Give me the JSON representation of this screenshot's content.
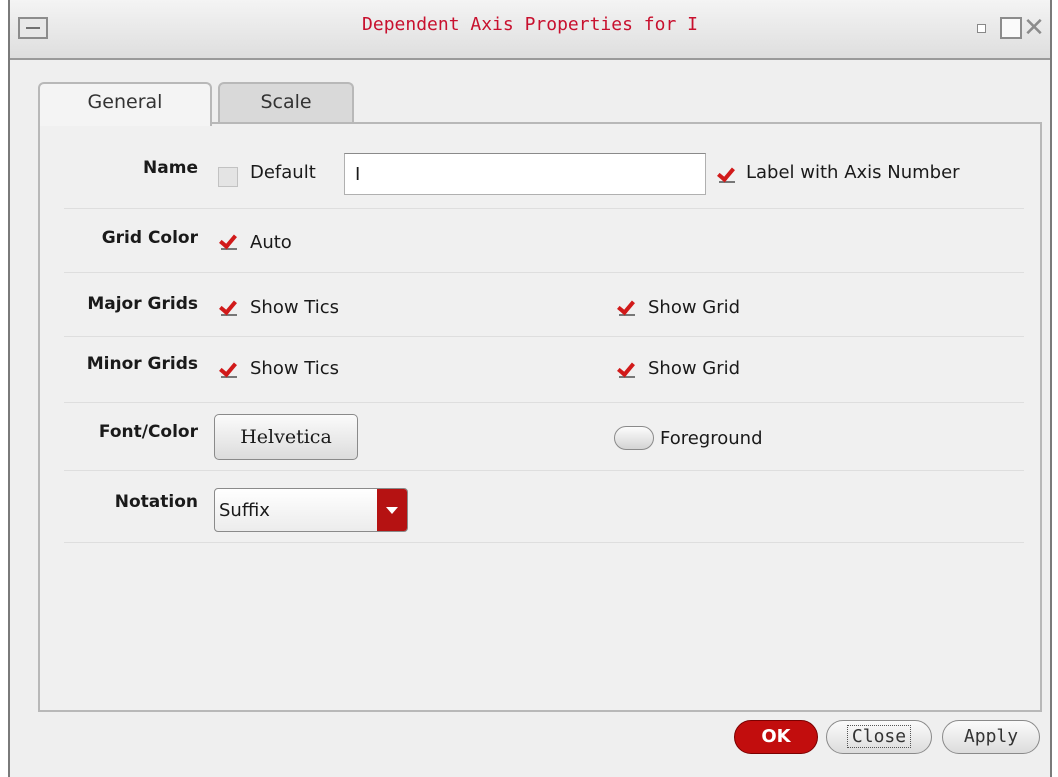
{
  "window": {
    "title": "Dependent Axis Properties for I",
    "accent_color": "#c8102e"
  },
  "tabs": [
    {
      "label": "General",
      "active": true
    },
    {
      "label": "Scale",
      "active": false
    }
  ],
  "general": {
    "name": {
      "label": "Name",
      "default_label": "Default",
      "default_checked": false,
      "value": "I",
      "axis_number_label": "Label with Axis Number",
      "axis_number_checked": true
    },
    "grid_color": {
      "label": "Grid Color",
      "auto_label": "Auto",
      "auto_checked": true
    },
    "major_grids": {
      "label": "Major Grids",
      "tics_label": "Show Tics",
      "tics_checked": true,
      "grid_label": "Show Grid",
      "grid_checked": true
    },
    "minor_grids": {
      "label": "Minor Grids",
      "tics_label": "Show Tics",
      "tics_checked": true,
      "grid_label": "Show Grid",
      "grid_checked": true
    },
    "font_color": {
      "label": "Font/Color",
      "font_button": "Helvetica",
      "color_label": "Foreground"
    },
    "notation": {
      "label": "Notation",
      "selected": "Suffix"
    }
  },
  "buttons": {
    "ok": "OK",
    "close": "Close",
    "apply": "Apply"
  }
}
